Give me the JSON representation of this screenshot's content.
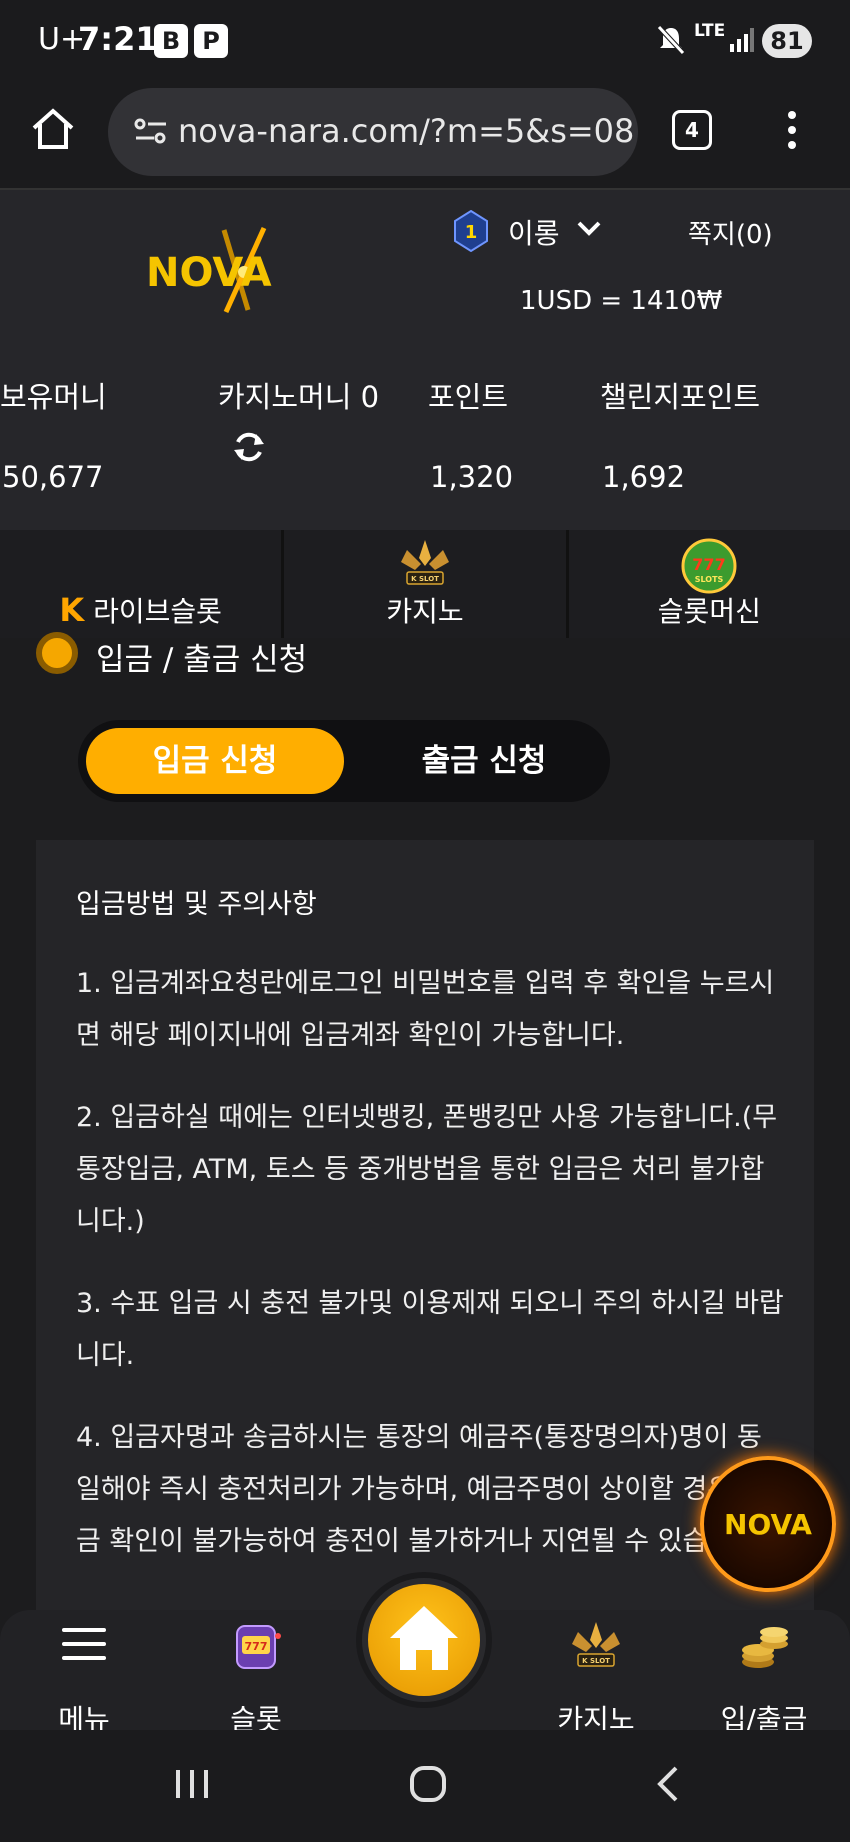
{
  "status_bar": {
    "carrier": "U+",
    "time": "7:21",
    "app_icon_1": "B",
    "app_icon_2": "P",
    "network": "LTE",
    "battery": "81"
  },
  "browser": {
    "url": "nova-nara.com/?m=5&s=08",
    "tab_count": "4"
  },
  "header": {
    "logo_text": "NOVA",
    "level": "1",
    "username": "이롱",
    "messages": "쪽지(0)",
    "exchange_rate": "1USD = 1410₩"
  },
  "balances": [
    {
      "label": "보유머니",
      "value": "50,677"
    },
    {
      "label": "카지노머니 0",
      "value": ""
    },
    {
      "label": "포인트",
      "value": "1,320"
    },
    {
      "label": "챌린지포인트",
      "value": "1,692"
    }
  ],
  "categories": [
    {
      "label": "라이브슬롯",
      "icon": "live-slot-icon"
    },
    {
      "label": "카지노",
      "icon": "k-slot-icon"
    },
    {
      "label": "슬롯머신",
      "icon": "777-slots-icon"
    }
  ],
  "section_title": "입금 / 출금 신청",
  "toggle": {
    "deposit": "입금 신청",
    "withdraw": "출금 신청"
  },
  "notice": {
    "title": "입금방법 및 주의사항",
    "items": [
      "1. 입금계좌요청란에로그인 비밀번호를 입력 후 확인을 누르시면 해당 페이지내에 입금계좌 확인이 가능합니다.",
      "2. 입금하실 때에는 인터넷뱅킹, 폰뱅킹만 사용 가능합니다.(무통장입금, ATM, 토스 등 중개방법을 통한 입금은 처리 불가합니다.)",
      "3. 수표 입금 시 충전 불가및 이용제재 되오니 주의 하시길 바랍니다.",
      "4. 입금자명과 송금하시는 통장의 예금주(통장명의자)명이 동일해야 즉시 충전처리가 가능하며, 예금주명이 상이할 경우 입금 확인이 불가능하여 충전이 불가하거나 지연될 수 있습니다."
    ]
  },
  "bottom_nav": {
    "menu": "메뉴",
    "slot": "슬롯",
    "casino": "카지노",
    "deposit_withdraw": "입/출금"
  },
  "colors": {
    "accent": "#ffae00",
    "background": "#1c1c1e",
    "header_bg": "#26262a"
  }
}
